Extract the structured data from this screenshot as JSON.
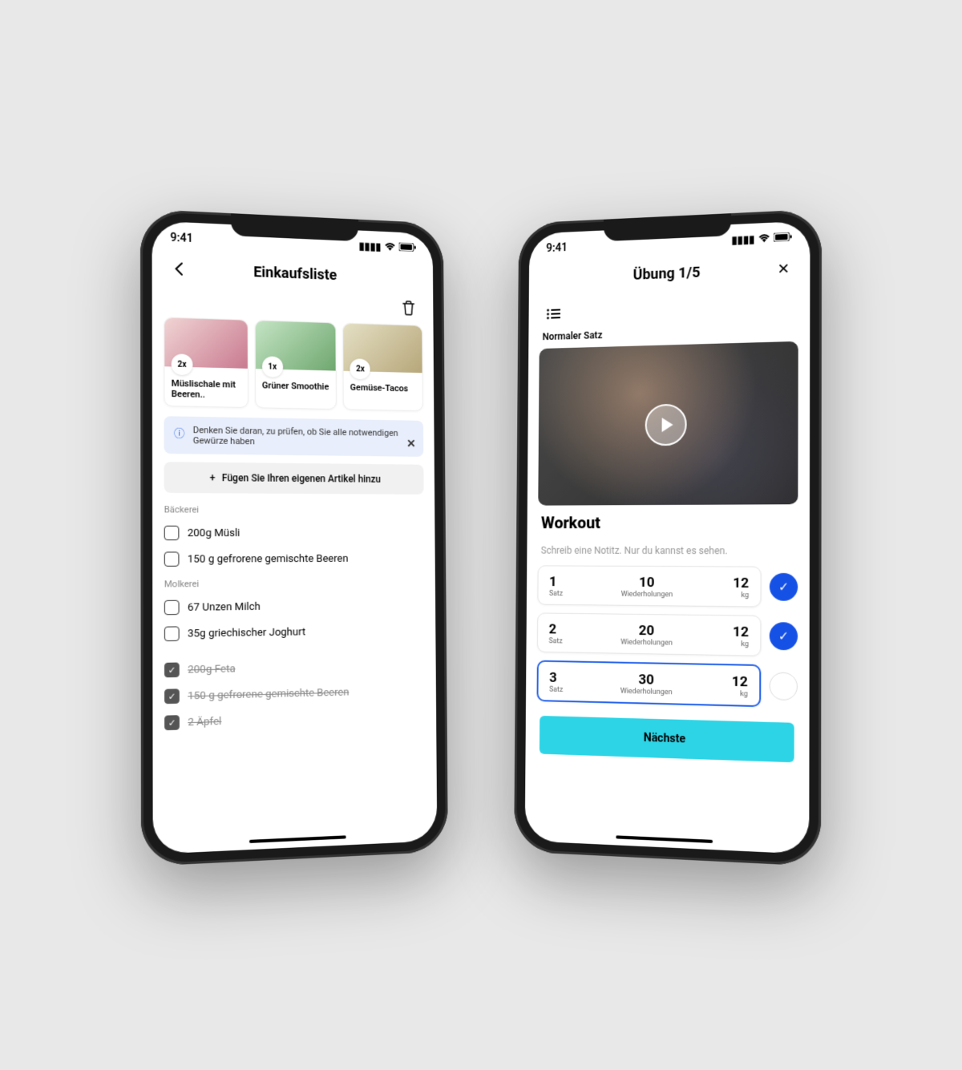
{
  "status_time": "9:41",
  "shopping": {
    "title": "Einkaufsliste",
    "recipes": [
      {
        "qty": "2x",
        "name": "Müslischale mit Beeren.."
      },
      {
        "qty": "1x",
        "name": "Grüner Smoothie"
      },
      {
        "qty": "2x",
        "name": "Gemüse-Tacos"
      }
    ],
    "info_banner": "Denken Sie daran, zu prüfen, ob Sie alle notwendigen Gewürze haben",
    "add_item_label": "Fügen Sie Ihren eigenen Artikel hinzu",
    "sections": [
      {
        "name": "Bäckerei",
        "items": [
          {
            "text": "200g Müsli",
            "checked": false
          },
          {
            "text": "150 g gefrorene gemischte Beeren",
            "checked": false
          }
        ]
      },
      {
        "name": "Molkerei",
        "items": [
          {
            "text": "67 Unzen Milch",
            "checked": false
          },
          {
            "text": "35g griechischer Joghurt",
            "checked": false
          }
        ]
      }
    ],
    "completed_items": [
      {
        "text": "200g Feta"
      },
      {
        "text": "150 g gefrorene gemischte Beeren"
      },
      {
        "text": "2 Äpfel"
      }
    ]
  },
  "workout": {
    "title": "Übung 1/5",
    "set_type": "Normaler Satz",
    "section_title": "Workout",
    "note_placeholder": "Schreib eine Notitz. Nur du kannst es sehen.",
    "sets": [
      {
        "set": "1",
        "set_label": "Satz",
        "reps": "10",
        "reps_label": "Wiederholungen",
        "weight": "12",
        "weight_label": "kg",
        "done": true,
        "active": false
      },
      {
        "set": "2",
        "set_label": "Satz",
        "reps": "20",
        "reps_label": "Wiederholungen",
        "weight": "12",
        "weight_label": "kg",
        "done": true,
        "active": false
      },
      {
        "set": "3",
        "set_label": "Satz",
        "reps": "30",
        "reps_label": "Wiederholungen",
        "weight": "12",
        "weight_label": "kg",
        "done": false,
        "active": true
      }
    ],
    "next_label": "Nächste"
  }
}
